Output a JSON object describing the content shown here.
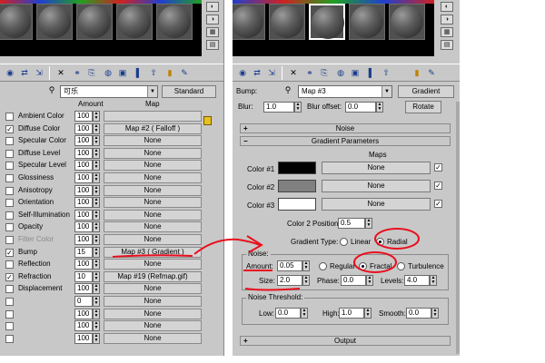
{
  "left": {
    "material_name": "可乐",
    "material_type": "Standard",
    "col_amount": "Amount",
    "col_map": "Map",
    "maps": [
      {
        "label": "Ambient Color",
        "amount": "100",
        "map": "",
        "checked": false,
        "dim": false
      },
      {
        "label": "Diffuse Color",
        "amount": "100",
        "map": "Map #2  ( Falloff )",
        "checked": true,
        "dim": false
      },
      {
        "label": "Specular Color",
        "amount": "100",
        "map": "None",
        "checked": false,
        "dim": false
      },
      {
        "label": "Diffuse Level",
        "amount": "100",
        "map": "None",
        "checked": false,
        "dim": false
      },
      {
        "label": "Specular Level",
        "amount": "100",
        "map": "None",
        "checked": false,
        "dim": false
      },
      {
        "label": "Glossiness",
        "amount": "100",
        "map": "None",
        "checked": false,
        "dim": false
      },
      {
        "label": "Anisotropy",
        "amount": "100",
        "map": "None",
        "checked": false,
        "dim": false
      },
      {
        "label": "Orientation",
        "amount": "100",
        "map": "None",
        "checked": false,
        "dim": false
      },
      {
        "label": "Self-Illumination",
        "amount": "100",
        "map": "None",
        "checked": false,
        "dim": false
      },
      {
        "label": "Opacity",
        "amount": "100",
        "map": "None",
        "checked": false,
        "dim": false
      },
      {
        "label": "Filter Color",
        "amount": "100",
        "map": "None",
        "checked": false,
        "dim": true
      },
      {
        "label": "Bump",
        "amount": "15",
        "map": "Map #3  ( Gradient )",
        "checked": true,
        "dim": false
      },
      {
        "label": "Reflection",
        "amount": "100",
        "map": "None",
        "checked": false,
        "dim": false
      },
      {
        "label": "Refraction",
        "amount": "10",
        "map": "Map #19 (Refmap.gif)",
        "checked": true,
        "dim": false
      },
      {
        "label": "Displacement",
        "amount": "100",
        "map": "None",
        "checked": false,
        "dim": false
      },
      {
        "label": "",
        "amount": "0",
        "map": "None",
        "checked": false,
        "dim": true
      },
      {
        "label": "",
        "amount": "100",
        "map": "None",
        "checked": false,
        "dim": true
      },
      {
        "label": "",
        "amount": "100",
        "map": "None",
        "checked": false,
        "dim": true
      },
      {
        "label": "",
        "amount": "100",
        "map": "None",
        "checked": false,
        "dim": true
      }
    ]
  },
  "right": {
    "slot_label": "Bump:",
    "map_name": "Map #3",
    "map_type": "Gradient",
    "blur_label": "Blur:",
    "blur_value": "1.0",
    "blur_offset_label": "Blur offset:",
    "blur_offset_value": "0.0",
    "rotate_label": "Rotate",
    "noise_rollout": "Noise",
    "gradient_rollout": "Gradient Parameters",
    "maps_header": "Maps",
    "colors": [
      {
        "label": "Color #1",
        "swatch": "#000000",
        "map": "None"
      },
      {
        "label": "Color #2",
        "swatch": "#808080",
        "map": "None"
      },
      {
        "label": "Color #3",
        "swatch": "#ffffff",
        "map": "None"
      }
    ],
    "color2_pos_label": "Color 2 Position:",
    "color2_pos_value": "0.5",
    "gradient_type_label": "Gradient Type:",
    "gradient_type_linear": "Linear",
    "gradient_type_radial": "Radial",
    "noise_group": "Noise:",
    "amount_label": "Amount:",
    "amount_value": "0.05",
    "noise_regular": "Regular",
    "noise_fractal": "Fractal",
    "noise_turbulence": "Turbulence",
    "size_label": "Size:",
    "size_value": "2.0",
    "phase_label": "Phase:",
    "phase_value": "0.0",
    "levels_label": "Levels:",
    "levels_value": "4.0",
    "threshold_group": "Noise Threshold:",
    "low_label": "Low:",
    "low_value": "0.0",
    "high_label": "High:",
    "high_value": "1.0",
    "smooth_label": "Smooth:",
    "smooth_value": "0.0",
    "output_rollout": "Output"
  },
  "colors": {
    "annotation_red": "#e8101e",
    "panel_gray": "#c8c8c8"
  }
}
